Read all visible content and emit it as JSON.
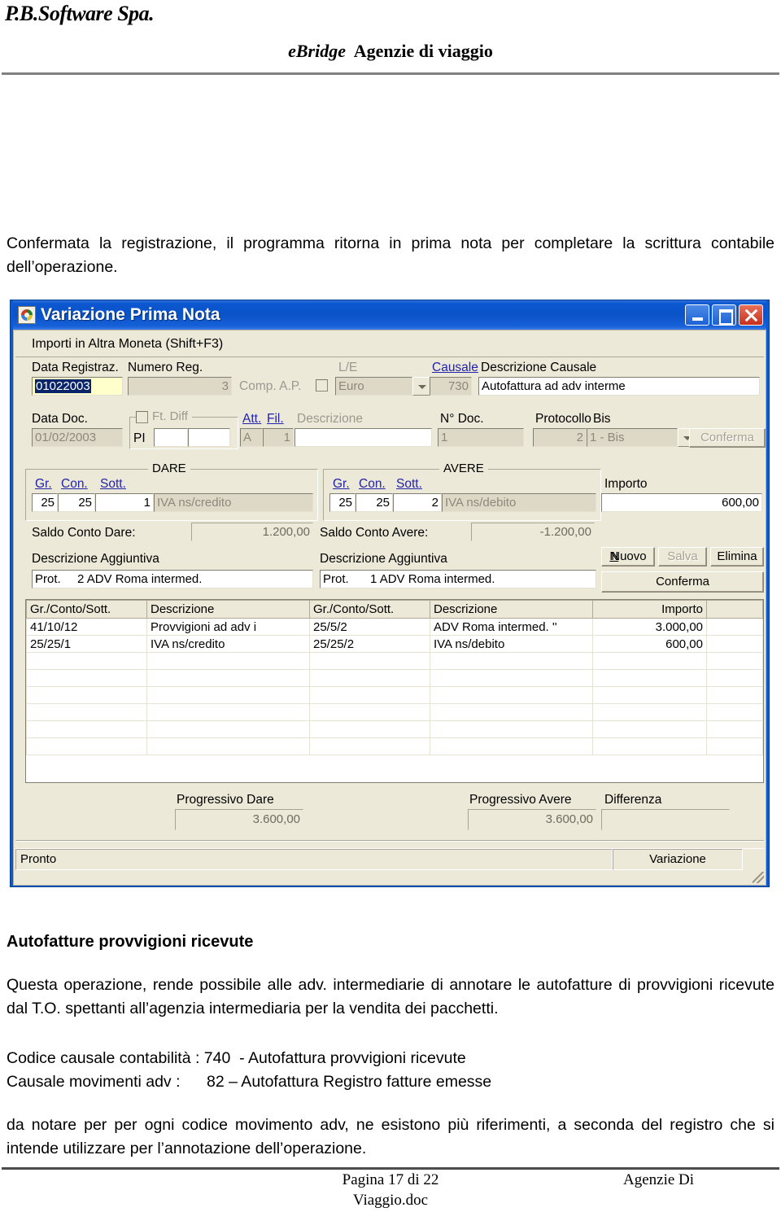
{
  "header": {
    "company": "P.B.Software Spa.",
    "title_italic": "eBridge",
    "title_rest": "Agenzie di viaggio"
  },
  "intro_paragraph": "Confermata la registrazione, il programma ritorna in prima nota per completare la scrittura contabile dell’operazione.",
  "dialog": {
    "title": "Variazione Prima Nota",
    "window_buttons": {
      "minimize": "minimize-button",
      "maximize": "maximize-button",
      "close": "close-button"
    },
    "toolbar_hint": "Importi in Altra Moneta (Shift+F3)",
    "row1": {
      "data_registraz_label": "Data Registraz.",
      "data_registraz_value": "01022003",
      "numero_reg_label": "Numero Reg.",
      "numero_reg_value": "3",
      "comp_ap_label": "Comp. A.P.",
      "le_label": "L/E",
      "le_value": "Euro",
      "causale_label": "Causale",
      "causale_value": "730",
      "descrizione_causale_label": "Descrizione Causale",
      "descrizione_causale_value": "Autofattura ad adv interme"
    },
    "row2": {
      "data_doc_label": "Data Doc.",
      "data_doc_value": "01/02/2003",
      "ft_diff_label": "Ft. Diff",
      "pi_label": "PI",
      "pi_value1": "",
      "pi_value2": "",
      "att_label": "Att.",
      "att_value": "A",
      "fil_label": "Fil.",
      "fil_value": "1",
      "descrizione_label": "Descrizione",
      "descrizione_value": "",
      "n_doc_label": "N° Doc.",
      "n_doc_value": "1",
      "protocollo_label": "Protocollo",
      "protocollo_value": "2",
      "bis_label": "Bis",
      "bis_value": "1 - Bis",
      "conferma_label": "Conferma"
    },
    "dare": {
      "group_title": "DARE",
      "gr_label": "Gr.",
      "con_label": "Con.",
      "sott_label": "Sott.",
      "gr_value": "25",
      "con_value": "25",
      "sott_value": "1",
      "descrizione_value": "IVA ns/credito"
    },
    "avere": {
      "group_title": "AVERE",
      "gr_label": "Gr.",
      "con_label": "Con.",
      "sott_label": "Sott.",
      "gr_value": "25",
      "con_value": "25",
      "sott_value": "2",
      "descrizione_value": "IVA ns/debito",
      "importo_label": "Importo",
      "importo_value": "600,00"
    },
    "saldi": {
      "saldo_dare_label": "Saldo Conto Dare:",
      "saldo_dare_value": "1.200,00",
      "saldo_avere_label": "Saldo Conto Avere:",
      "saldo_avere_value": "-1.200,00"
    },
    "descrizioni_aggiuntive": {
      "label_left": "Descrizione Aggiuntiva",
      "prot_left_label": "Prot.",
      "prot_left_value": "2 ADV Roma intermed.",
      "label_right": "Descrizione Aggiuntiva",
      "prot_right_label": "Prot.",
      "prot_right_value": "1 ADV Roma intermed."
    },
    "buttons": {
      "nuovo": "Nuovo",
      "salva": "Salva",
      "elimina": "Elimina",
      "conferma": "Conferma"
    },
    "grid": {
      "headers": [
        "Gr./Conto/Sott.",
        "Descrizione",
        "Gr./Conto/Sott.",
        "Descrizione",
        "Importo",
        ""
      ],
      "rows": [
        [
          "41/10/12",
          "Provvigioni ad adv i",
          "25/5/2",
          "ADV Roma intermed. ''",
          "3.000,00",
          ""
        ],
        [
          "25/25/1",
          "IVA ns/credito",
          "25/25/2",
          "IVA ns/debito",
          "600,00",
          ""
        ]
      ],
      "empty_row_count": 5
    },
    "totali": {
      "progressivo_dare_label": "Progressivo Dare",
      "progressivo_dare_value": "3.600,00",
      "progressivo_avere_label": "Progressivo Avere",
      "progressivo_avere_value": "3.600,00",
      "differenza_label": "Differenza",
      "differenza_value": ""
    },
    "statusbar": {
      "left": "Pronto",
      "right": "Variazione"
    }
  },
  "section_heading": "Autofatture provvigioni ricevute",
  "paragraph2": "Questa operazione, rende possibile alle adv. intermediarie di annotare le autofatture di provvigioni ricevute dal T.O. spettanti all’agenzia intermediaria per la vendita dei pacchetti.",
  "codes": {
    "line1": "Codice causale contabilità : 740  - Autofattura provvigioni ricevute",
    "line2": "Causale movimenti adv :      82 – Autofattura Registro fatture emesse"
  },
  "paragraph3": "da notare per per ogni codice movimento adv, ne esistono più riferimenti,  a seconda del registro che si intende utilizzare per l’annotazione dell’operazione.",
  "footer": {
    "page": "Pagina 17 di 22",
    "filename_line1": "Viaggio.doc",
    "doc_right": "Agenzie Di"
  },
  "colors": {
    "titlebar_blue": "#0A5BD3",
    "dialog_face": "#ECE9D8",
    "selection_blue": "#0A246A",
    "field_yellow": "#FFFFCC",
    "link_blue": "#2222AA"
  }
}
